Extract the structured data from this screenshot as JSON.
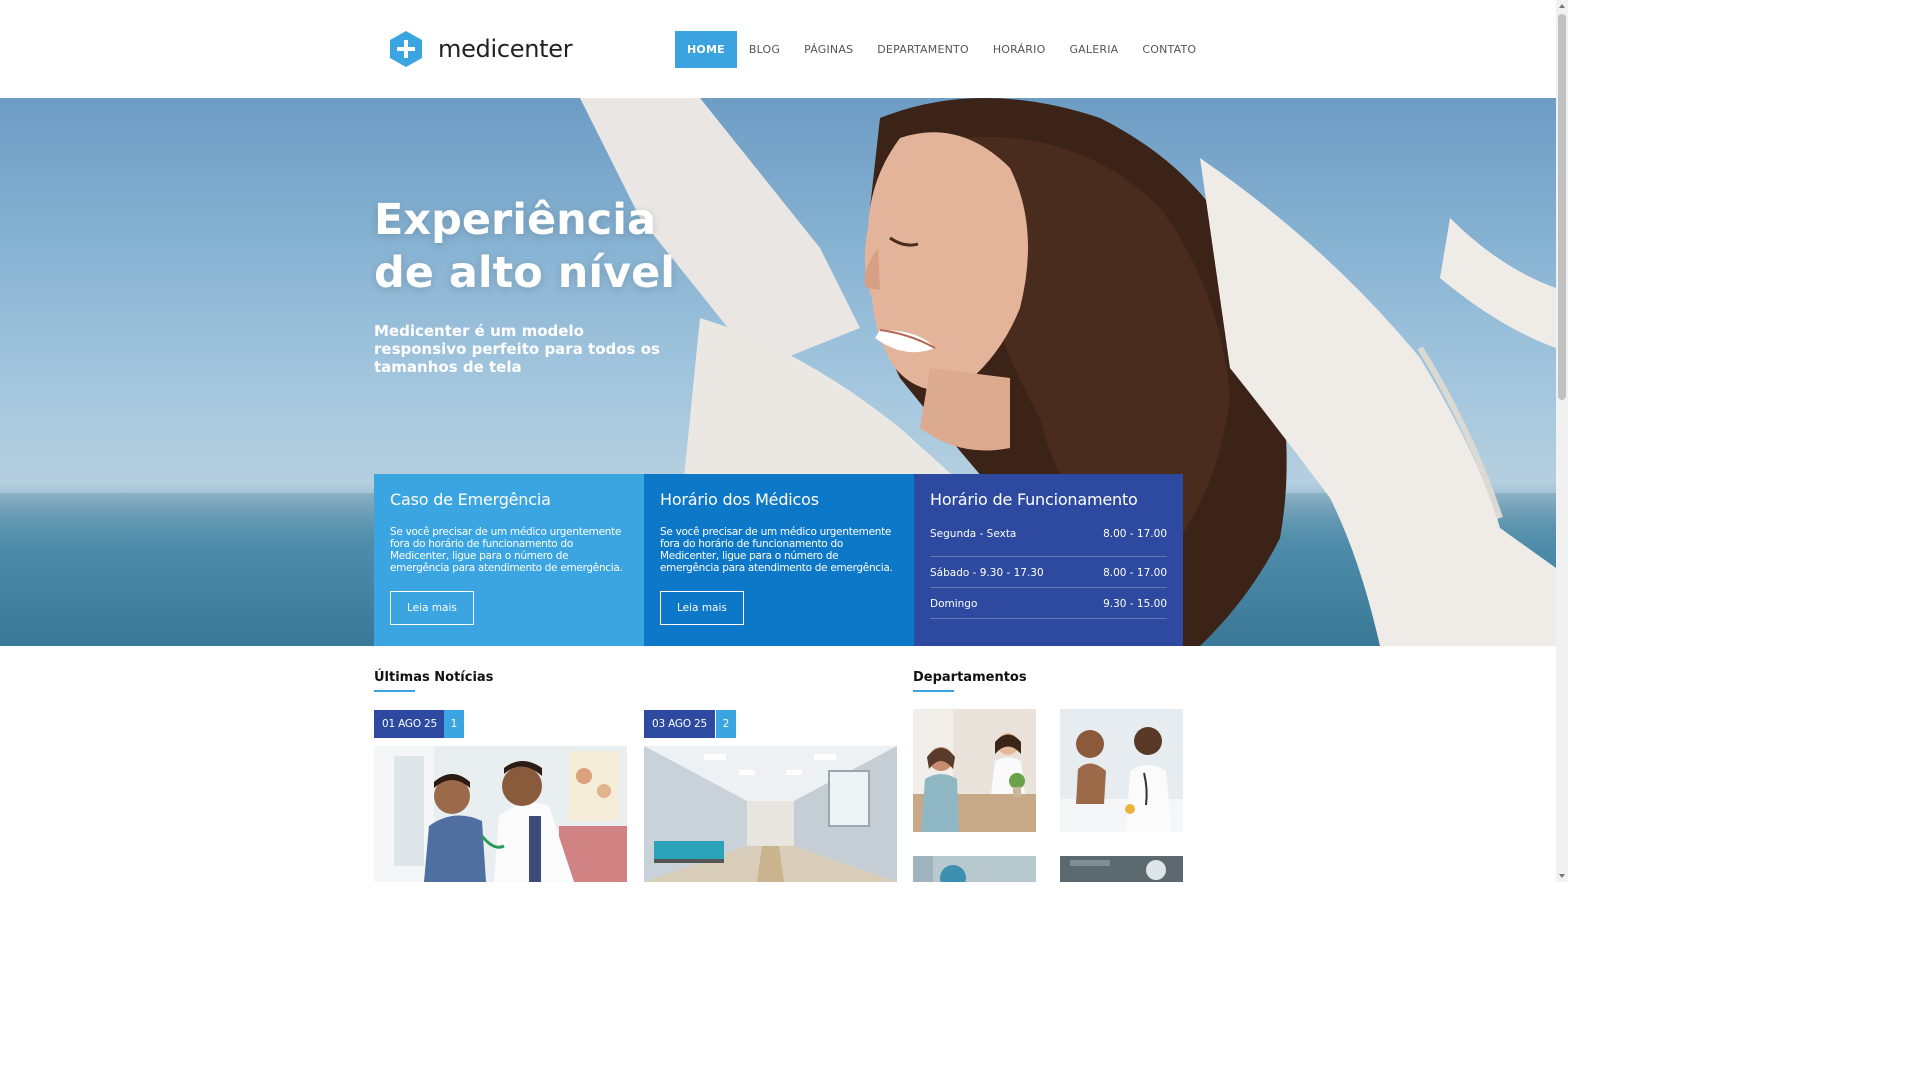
{
  "brand": {
    "name": "medicenter",
    "accent": "#3ba3e0"
  },
  "nav": {
    "items": [
      {
        "label": "HOME",
        "active": true
      },
      {
        "label": "BLOG",
        "active": false
      },
      {
        "label": "PÁGINAS",
        "active": false
      },
      {
        "label": "DEPARTAMENTO",
        "active": false
      },
      {
        "label": "HORÁRIO",
        "active": false
      },
      {
        "label": "GALERIA",
        "active": false
      },
      {
        "label": "CONTATO",
        "active": false
      }
    ]
  },
  "hero": {
    "title_line1": "Experiência",
    "title_line2": "de alto nível",
    "subtitle": "Medicenter é um modelo responsivo perfeito para todos os tamanhos de tela"
  },
  "boxes": {
    "emergency": {
      "title": "Caso de Emergência",
      "text": "Se você precisar de um médico urgentemente fora do horário de funcionamento do Medicenter, ligue para o número de emergência para atendimento de emergência.",
      "button": "Leia mais"
    },
    "doctors": {
      "title": "Horário dos Médicos",
      "text": "Se você precisar de um médico urgentemente fora do horário de funcionamento do Medicenter, ligue para o número de emergência para atendimento de emergência.",
      "button": "Leia mais"
    },
    "hours": {
      "title": "Horário de Funcionamento",
      "rows": [
        {
          "day": "Segunda - Sexta",
          "time": "8.00 - 17.00"
        },
        {
          "day": "Sábado - 9.30 - 17.30",
          "time": "8.00 - 17.00"
        },
        {
          "day": "Domingo",
          "time": "9.30 - 15.00"
        }
      ]
    }
  },
  "news": {
    "title": "Últimas Notícias",
    "items": [
      {
        "date": "01 AGO 25",
        "comments": "1"
      },
      {
        "date": "03 AGO 25",
        "comments": "2"
      }
    ]
  },
  "departments": {
    "title": "Departamentos"
  }
}
